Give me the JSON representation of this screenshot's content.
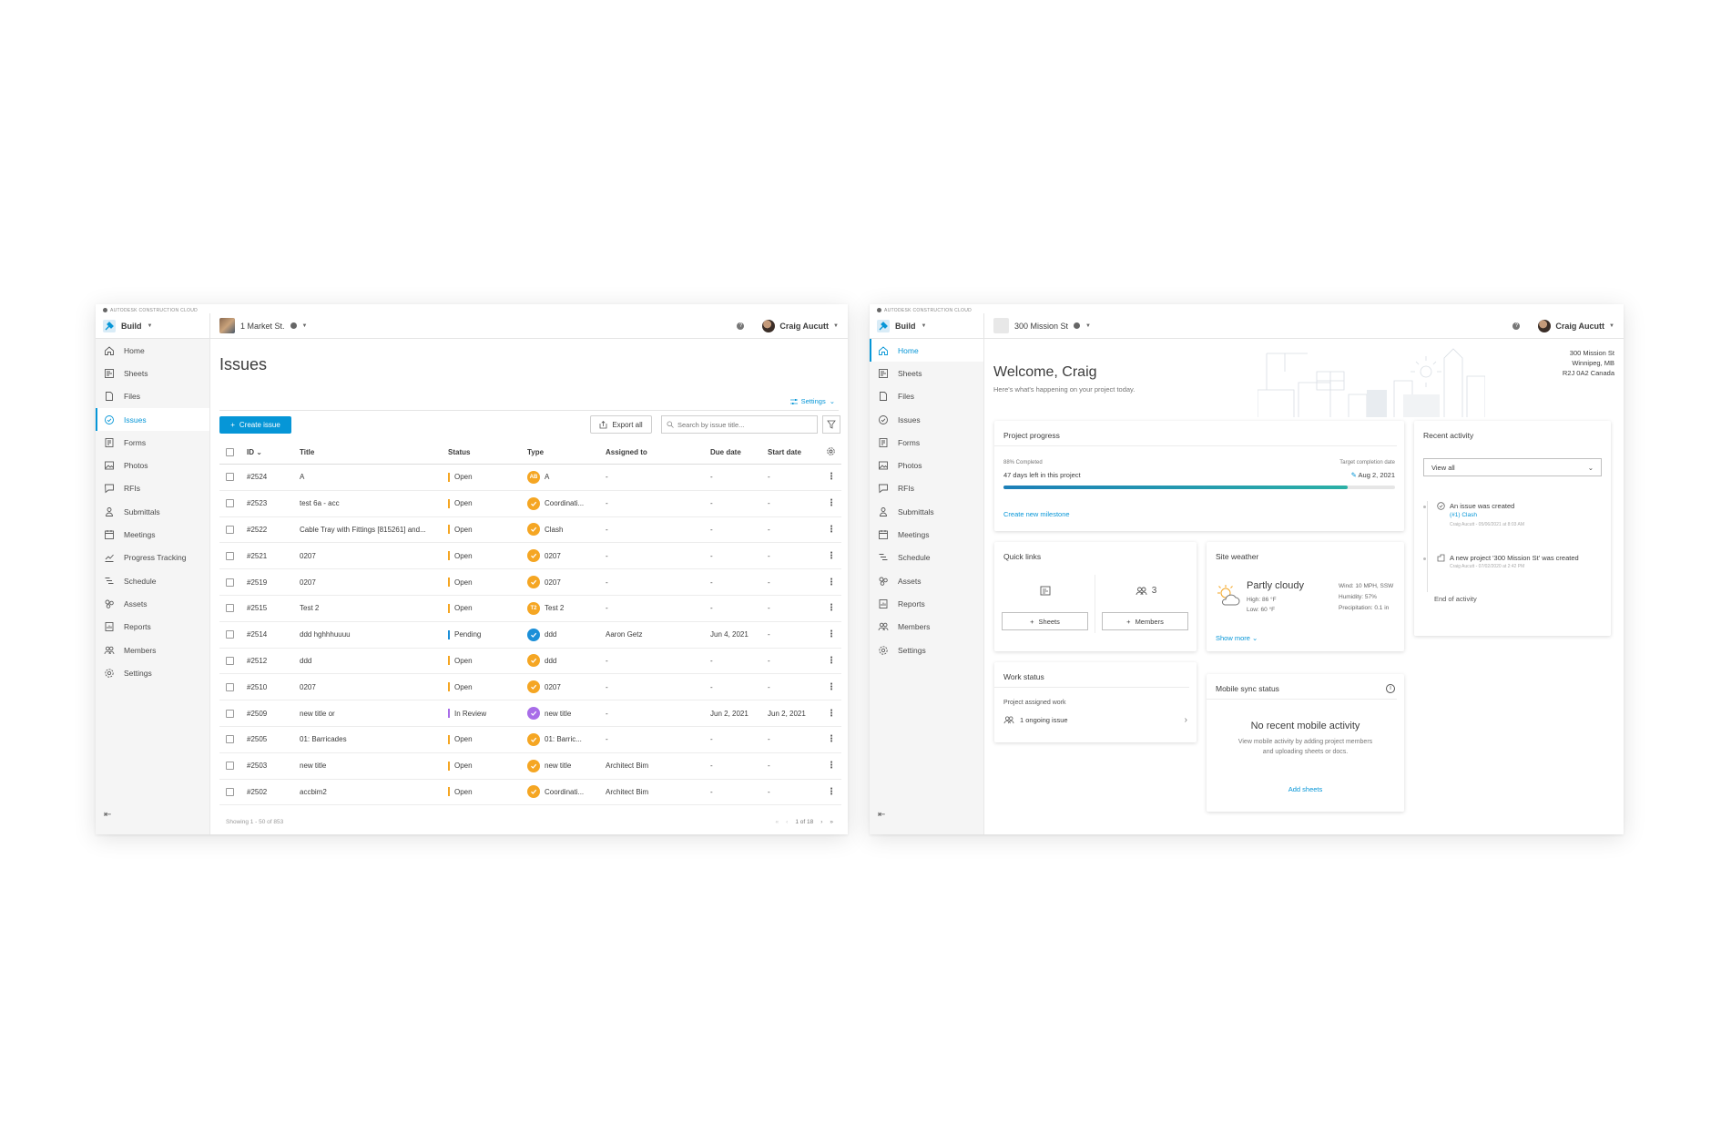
{
  "brand": {
    "label": "AUTODESK CONSTRUCTION CLOUD"
  },
  "issues_window": {
    "topbar": {
      "app": "Build",
      "project": "1 Market St.",
      "user": "Craig Aucutt"
    },
    "nav": [
      "Home",
      "Sheets",
      "Files",
      "Issues",
      "Forms",
      "Photos",
      "RFIs",
      "Submittals",
      "Meetings",
      "Progress Tracking",
      "Schedule",
      "Assets",
      "Reports",
      "Members",
      "Settings"
    ],
    "active_nav": "Issues",
    "page_title": "Issues",
    "settings_label": "Settings",
    "create_label": "Create issue",
    "export_label": "Export all",
    "search_placeholder": "Search by issue title...",
    "columns": {
      "id": "ID",
      "title": "Title",
      "status": "Status",
      "type": "Type",
      "assigned": "Assigned to",
      "due": "Due date",
      "start": "Start date"
    },
    "rows": [
      {
        "id": "#2524",
        "title": "A",
        "status": "Open",
        "status_color": "#f5a623",
        "badge": "AB",
        "badge_kind": "text-orange",
        "type": "A",
        "assigned": "-",
        "due": "-",
        "start": "-"
      },
      {
        "id": "#2523",
        "title": "test 6a - acc",
        "status": "Open",
        "status_color": "#f5a623",
        "badge": "",
        "badge_kind": "check-orange",
        "type": "Coordinati...",
        "assigned": "-",
        "due": "-",
        "start": "-"
      },
      {
        "id": "#2522",
        "title": "Cable Tray with Fittings [815261] and...",
        "status": "Open",
        "status_color": "#f5a623",
        "badge": "",
        "badge_kind": "check-orange",
        "type": "Clash",
        "assigned": "-",
        "due": "-",
        "start": "-"
      },
      {
        "id": "#2521",
        "title": "0207",
        "status": "Open",
        "status_color": "#f5a623",
        "badge": "",
        "badge_kind": "check-orange",
        "type": "0207",
        "assigned": "-",
        "due": "-",
        "start": "-"
      },
      {
        "id": "#2519",
        "title": "0207",
        "status": "Open",
        "status_color": "#f5a623",
        "badge": "",
        "badge_kind": "check-orange",
        "type": "0207",
        "assigned": "-",
        "due": "-",
        "start": "-"
      },
      {
        "id": "#2515",
        "title": "Test 2",
        "status": "Open",
        "status_color": "#f5a623",
        "badge": "T2",
        "badge_kind": "text-orange",
        "type": "Test 2",
        "assigned": "-",
        "due": "-",
        "start": "-"
      },
      {
        "id": "#2514",
        "title": "ddd hghhhuuuu",
        "status": "Pending",
        "status_color": "#1b8fd8",
        "badge": "",
        "badge_kind": "check-blue",
        "type": "ddd",
        "assigned": "Aaron Getz",
        "due": "Jun 4, 2021",
        "start": "-"
      },
      {
        "id": "#2512",
        "title": "ddd",
        "status": "Open",
        "status_color": "#f5a623",
        "badge": "",
        "badge_kind": "check-orange",
        "type": "ddd",
        "assigned": "-",
        "due": "-",
        "start": "-"
      },
      {
        "id": "#2510",
        "title": "0207",
        "status": "Open",
        "status_color": "#f5a623",
        "badge": "",
        "badge_kind": "check-orange",
        "type": "0207",
        "assigned": "-",
        "due": "-",
        "start": "-"
      },
      {
        "id": "#2509",
        "title": "new title or",
        "status": "In Review",
        "status_color": "#a86de8",
        "badge": "",
        "badge_kind": "check-purple",
        "type": "new title",
        "assigned": "-",
        "due": "Jun 2, 2021",
        "start": "Jun 2, 2021"
      },
      {
        "id": "#2505",
        "title": "01: Barricades",
        "status": "Open",
        "status_color": "#f5a623",
        "badge": "",
        "badge_kind": "check-orange",
        "type": "01: Barric...",
        "assigned": "-",
        "due": "-",
        "start": "-"
      },
      {
        "id": "#2503",
        "title": "new title",
        "status": "Open",
        "status_color": "#f5a623",
        "badge": "",
        "badge_kind": "check-orange",
        "type": "new title",
        "assigned": "Architect Bim",
        "due": "-",
        "start": "-"
      },
      {
        "id": "#2502",
        "title": "accbim2",
        "status": "Open",
        "status_color": "#f5a623",
        "badge": "",
        "badge_kind": "check-orange",
        "type": "Coordinati...",
        "assigned": "Architect Bim",
        "due": "-",
        "start": "-"
      }
    ],
    "footer": "Showing 1 - 50 of 853",
    "page_indicator": "1 of 18"
  },
  "home_window": {
    "topbar": {
      "app": "Build",
      "project": "300 Mission St",
      "user": "Craig Aucutt"
    },
    "nav": [
      "Home",
      "Sheets",
      "Files",
      "Issues",
      "Forms",
      "Photos",
      "RFIs",
      "Submittals",
      "Meetings",
      "Schedule",
      "Assets",
      "Reports",
      "Members",
      "Settings"
    ],
    "active_nav": "Home",
    "address": [
      "300 Mission St",
      "Winnipeg, MB",
      "R2J 0A2 Canada"
    ],
    "welcome": "Welcome, Craig",
    "welcome_sub": "Here's what's happening on your project today.",
    "progress": {
      "title": "Project progress",
      "completed": "88% Completed",
      "value": 0.88,
      "days_left": "47 days left in this project",
      "target_label": "Target completion date",
      "target_date": "Aug 2, 2021",
      "link": "Create new milestone"
    },
    "recent": {
      "title": "Recent activity",
      "filter": "View all",
      "items": [
        {
          "text": "An issue was created",
          "sub": "(#1) Clash",
          "meta": "Craig Aucutt - 05/06/2021 at 8:03 AM"
        },
        {
          "text": "A new project '300 Mission St' was created",
          "sub": "",
          "meta": "Craig Aucutt - 07/02/2020 at 2:42 PM"
        }
      ],
      "end": "End of activity"
    },
    "quick_links": {
      "title": "Quick links",
      "members_count": "3",
      "sheets_label": "Sheets",
      "members_label": "Members"
    },
    "weather": {
      "title": "Site weather",
      "condition": "Partly cloudy",
      "high": "High: 86 °F",
      "low": "Low: 60 °F",
      "wind": "Wind: 10 MPH, SSW",
      "humidity": "Humidity: 57%",
      "precipitation": "Precipitation: 0.1 in",
      "more": "Show more"
    },
    "work": {
      "title": "Work status",
      "sub": "Project assigned work",
      "row": "1 ongoing issue"
    },
    "mobile": {
      "title": "Mobile sync status",
      "heading": "No recent mobile activity",
      "desc": "View mobile activity by adding project members and uploading sheets or docs.",
      "link": "Add sheets"
    }
  }
}
